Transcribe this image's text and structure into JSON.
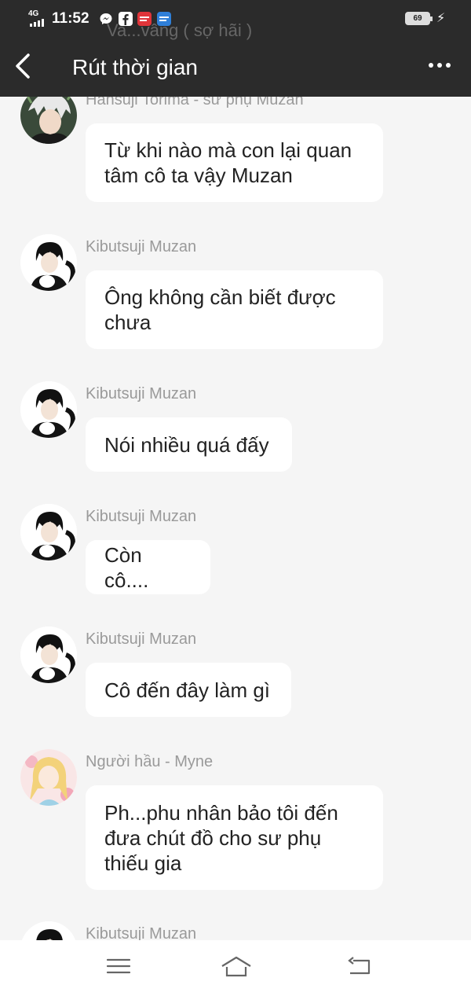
{
  "status_bar": {
    "network": "4G",
    "time": "11:52",
    "battery": "69",
    "ghost_text": "Va...vâng ( sợ hãi )"
  },
  "header": {
    "title": "Rút thời gian"
  },
  "messages": [
    {
      "sender": "Hansuji Torima - sư phụ Muzan",
      "lines": [
        "Từ khi nào mà con lại quan",
        "tâm cô ta vậy Muzan"
      ],
      "avatar": "hansuji"
    },
    {
      "sender": "Kibutsuji Muzan",
      "lines": [
        "Ông không cần biết được",
        "chưa"
      ],
      "avatar": "muzan"
    },
    {
      "sender": "Kibutsuji Muzan",
      "lines": [
        "Nói nhiều quá đấy"
      ],
      "avatar": "muzan"
    },
    {
      "sender": "Kibutsuji Muzan",
      "lines": [
        "Còn cô...."
      ],
      "avatar": "muzan"
    },
    {
      "sender": "Kibutsuji Muzan",
      "lines": [
        "Cô đến đây làm gì"
      ],
      "avatar": "muzan"
    },
    {
      "sender": "Người hầu - Myne",
      "lines": [
        "Ph...phu nhân bảo tôi đến",
        "đưa chút đồ cho sư phụ",
        "thiếu gia"
      ],
      "avatar": "myne"
    },
    {
      "sender": "Kibutsuji Muzan",
      "lines": [],
      "avatar": "muzan"
    }
  ],
  "nav": {
    "icons": [
      "menu-icon",
      "home-icon",
      "back-icon"
    ]
  }
}
